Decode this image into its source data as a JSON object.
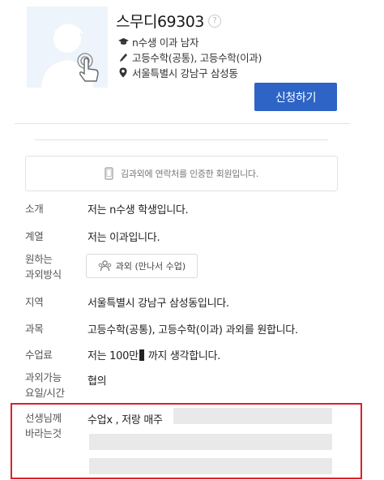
{
  "profile": {
    "name": "스무디69303",
    "help_symbol": "?",
    "info": [
      {
        "icon": "graduation-cap-icon",
        "text": "n수생 이과 남자"
      },
      {
        "icon": "pencil-icon",
        "text": "고등수학(공통), 고등수학(이과)"
      },
      {
        "icon": "location-pin-icon",
        "text": "서울특별시 강남구 삼성동"
      }
    ],
    "apply_label": "신청하기",
    "verified_text": "김과외에 연락처를 인증한 회원입니다."
  },
  "details": {
    "intro": {
      "label": "소개",
      "value": "저는 n수생 학생입니다."
    },
    "track": {
      "label": "계열",
      "value": "저는 이과입니다."
    },
    "method": {
      "label_1": "원하는",
      "label_2": "과외방식",
      "value": "과외 (만나서 수업)"
    },
    "region": {
      "label": "지역",
      "value": "서울특별시 강남구 삼성동입니다."
    },
    "subject": {
      "label": "과목",
      "value": "고등수학(공통), 고등수학(이과) 과외를 원합니다."
    },
    "fee": {
      "label": "수업료",
      "value": "저는 100만",
      "value_suffix": "까지 생각합니다."
    },
    "schedule": {
      "label_1": "과외가능",
      "label_2": "요일/시간",
      "value": "협의"
    },
    "to_teacher": {
      "label_1": "선생님께",
      "label_2": "바라는것",
      "value": "수업x , 저랑 매주"
    }
  },
  "colors": {
    "accent": "#2e64c5",
    "highlight_border": "#d9222a"
  }
}
